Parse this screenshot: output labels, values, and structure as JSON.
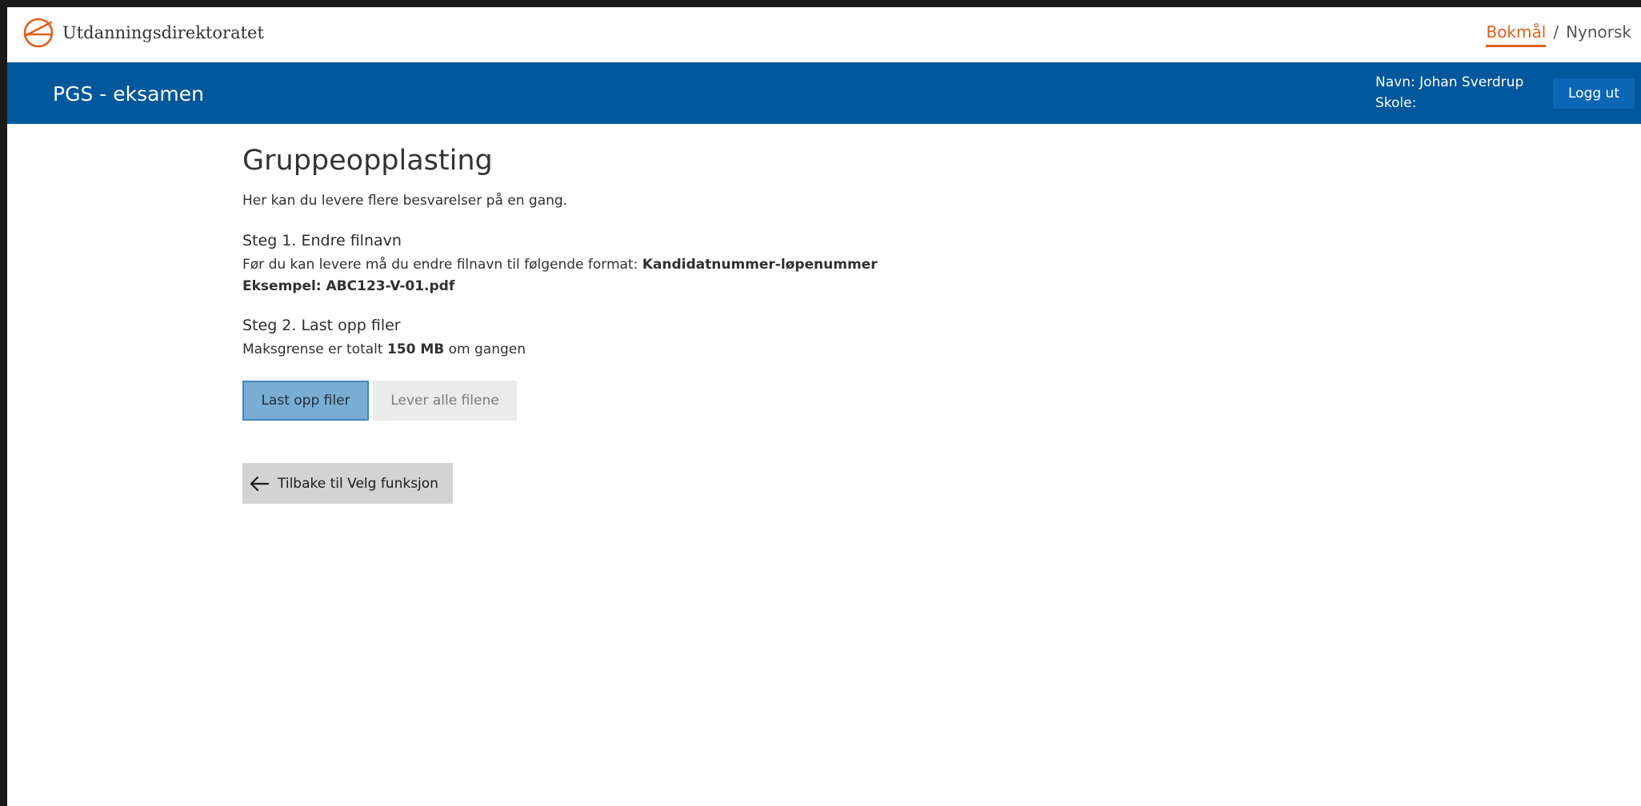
{
  "header": {
    "org_name": "Utdanningsdirektoratet",
    "language": {
      "active": "Bokmål",
      "separator": "/",
      "other": "Nynorsk"
    },
    "logo_icon": "udir-circle-logo-icon",
    "accent_color": "#e0601b"
  },
  "banner": {
    "app_title": "PGS - eksamen",
    "user_name_line": "Navn: Johan Sverdrup",
    "school_line": "Skole:",
    "logout_label": "Logg ut",
    "background_color": "#00579b"
  },
  "main": {
    "title": "Gruppeopplasting",
    "intro": "Her kan du levere flere besvarelser på en gang.",
    "step1": {
      "heading": "Steg 1. Endre filnavn",
      "text_prefix": "Før du kan levere må du endre filnavn til følgende format: ",
      "format": "Kandidatnummer-løpenummer",
      "example": "Eksempel: ABC123-V-01.pdf"
    },
    "step2": {
      "heading": "Steg 2. Last opp filer",
      "text_prefix": "Maksgrense er totalt ",
      "limit": "150 MB",
      "text_suffix": " om gangen"
    },
    "upload_label": "Last opp filer",
    "deliver_label": "Lever alle filene",
    "back_label": "Tilbake til Velg funksjon",
    "back_icon": "arrow-left-icon"
  }
}
